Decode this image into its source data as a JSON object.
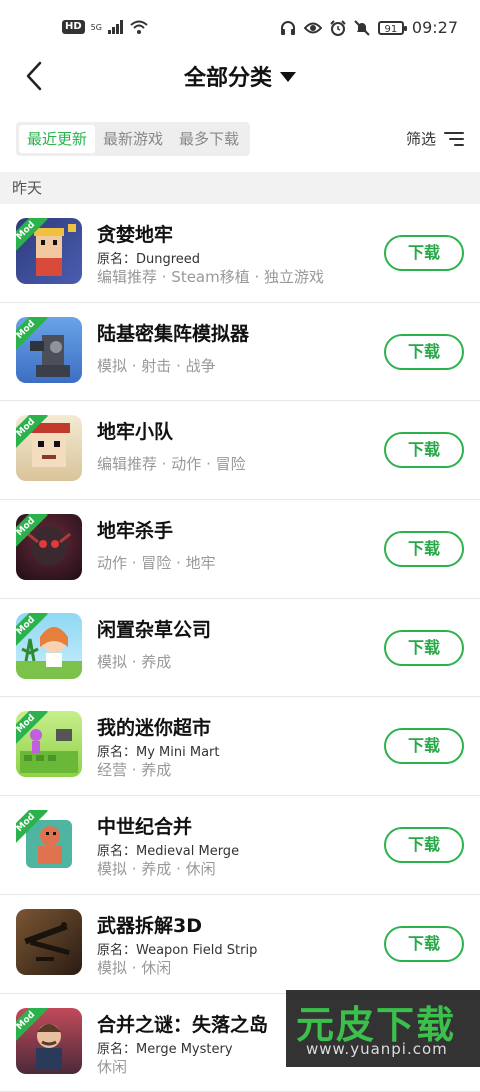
{
  "status_bar": {
    "hd": "HD",
    "signal": "5G",
    "battery": "91",
    "time": "09:27"
  },
  "header": {
    "title": "全部分类"
  },
  "tabs": [
    {
      "label": "最近更新",
      "active": true
    },
    {
      "label": "最新游戏",
      "active": false
    },
    {
      "label": "最多下载",
      "active": false
    }
  ],
  "filter": {
    "label": "筛选"
  },
  "section": {
    "label": "昨天"
  },
  "mod_label": "Mod",
  "download_label": "下载",
  "apps": [
    {
      "name": "贪婪地牢",
      "original": "原名：Dungreed",
      "tags": "编辑推荐 · Steam移植 · 独立游戏",
      "icon": "dungreed-icon",
      "colors": [
        "#3a4e9e",
        "#d84b3a"
      ]
    },
    {
      "name": "陆基密集阵模拟器",
      "original": "",
      "tags": "模拟 · 射击 · 战争",
      "icon": "cannon-icon",
      "colors": [
        "#5b8fd6",
        "#3a3f4a"
      ]
    },
    {
      "name": "地牢小队",
      "original": "",
      "tags": "编辑推荐 · 动作 · 冒险",
      "icon": "dungeon-squad-icon",
      "colors": [
        "#f1e6c8",
        "#c0392b"
      ]
    },
    {
      "name": "地牢杀手",
      "original": "",
      "tags": "动作 · 冒险 · 地牢",
      "icon": "dungeon-killer-icon",
      "colors": [
        "#3b1e2a",
        "#b33a3a"
      ]
    },
    {
      "name": "闲置杂草公司",
      "original": "",
      "tags": "模拟 · 养成",
      "icon": "weed-company-icon",
      "colors": [
        "#7fd0f0",
        "#e57f3b"
      ]
    },
    {
      "name": "我的迷你超市",
      "original": "原名：My Mini Mart",
      "tags": "经营 · 养成",
      "icon": "mini-mart-icon",
      "colors": [
        "#a6e05a",
        "#c25fe0"
      ]
    },
    {
      "name": "中世纪合并",
      "original": "原名：Medieval Merge",
      "tags": "模拟 · 养成 · 休闲",
      "icon": "medieval-merge-icon",
      "colors": [
        "#4fb5a0",
        "#e0734f"
      ]
    },
    {
      "name": "武器拆解3D",
      "original": "原名：Weapon Field Strip",
      "tags": "模拟 · 休闲",
      "icon": "weapon-strip-icon",
      "colors": [
        "#6b4a2b",
        "#2a1c12"
      ]
    },
    {
      "name": "合并之谜：失落之岛",
      "original": "原名：Merge Mystery",
      "tags": "休闲",
      "icon": "merge-mystery-icon",
      "colors": [
        "#b33a4a",
        "#4a2a3a"
      ]
    }
  ],
  "watermark": {
    "title": "元皮下载",
    "url": "www.yuanpi.com"
  }
}
